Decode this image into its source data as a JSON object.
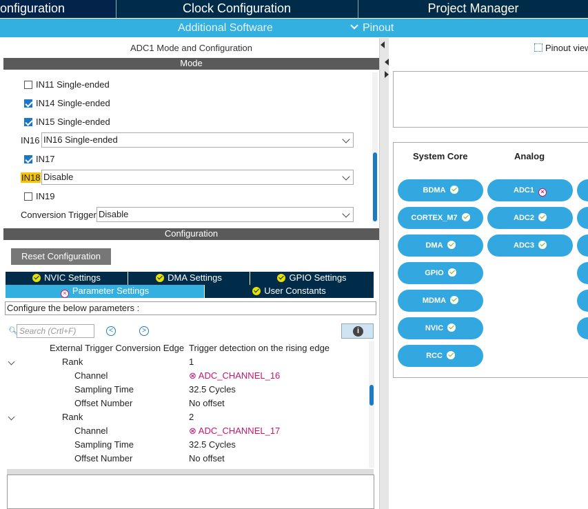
{
  "top_tabs": {
    "pinout": "onfiguration",
    "clock": "Clock Configuration",
    "project": "Project Manager"
  },
  "sub_bar": {
    "additional_software": "Additional Software",
    "pinout": "Pinout"
  },
  "adc_panel": {
    "title": "ADC1 Mode and Configuration",
    "mode_header": "Mode",
    "mode_items": [
      {
        "label": "IN11 Single-ended",
        "checked": false
      },
      {
        "label": "IN14 Single-ended",
        "checked": true
      },
      {
        "label": "IN15 Single-ended",
        "checked": true
      }
    ],
    "in16": {
      "label": "IN16",
      "value": "IN16 Single-ended"
    },
    "in17": {
      "label": "IN17",
      "checked": true
    },
    "in18": {
      "label": "IN18",
      "value": "Disable"
    },
    "in19": {
      "label": "IN19",
      "checked": false
    },
    "conversion_trigger": {
      "label": "Conversion Trigger",
      "value": "Disable"
    }
  },
  "config": {
    "header": "Configuration",
    "reset_button": "Reset Configuration",
    "tabs": {
      "nvic": "NVIC Settings",
      "dma": "DMA Settings",
      "gpio": "GPIO Settings",
      "params": "Parameter Settings",
      "user_constants": "User Constants"
    },
    "hint": "Configure the below parameters :",
    "search_placeholder": "Search (Crtl+F)",
    "params": [
      {
        "name": "External Trigger Conversion Edge",
        "value": "Trigger detection on the rising edge"
      },
      {
        "name": "Rank",
        "value": "1"
      },
      {
        "name": "Channel",
        "value": "ADC_CHANNEL_16"
      },
      {
        "name": "Sampling Time",
        "value": "32.5 Cycles"
      },
      {
        "name": "Offset Number",
        "value": "No offset"
      },
      {
        "name": "Rank",
        "value": "2"
      },
      {
        "name": "Channel",
        "value": "ADC_CHANNEL_17"
      },
      {
        "name": "Sampling Time",
        "value": "32.5 Cycles"
      },
      {
        "name": "Offset Number",
        "value": "No offset"
      }
    ]
  },
  "right_panel": {
    "pinout_view": "Pinout view",
    "categories": {
      "system_core": "System Core",
      "analog": "Analog"
    },
    "system_core": [
      "BDMA",
      "CORTEX_M7",
      "DMA",
      "GPIO",
      "MDMA",
      "NVIC",
      "RCC"
    ],
    "analog": [
      "ADC1",
      "ADC2",
      "ADC3"
    ]
  },
  "colors": {
    "accent": "#33b0e0",
    "navy": "#002b49",
    "error": "#c2186b",
    "highlight": "#f5c400"
  }
}
